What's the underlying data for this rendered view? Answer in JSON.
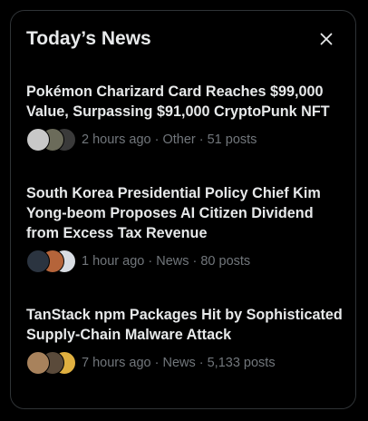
{
  "header": {
    "title": "Today’s News",
    "close_icon": "close-icon"
  },
  "stories": [
    {
      "headline": "Pokémon Charizard Card Reaches $99,000 Value, Surpassing $91,000 CryptoPunk NFT",
      "meta": "2 hours ago · Other · 51 posts",
      "avatar_colors": [
        "#c8c8c8",
        "#6b6b5a",
        "#3a3a3a"
      ]
    },
    {
      "headline": "South Korea Presidential Policy Chief Kim Yong-beom Proposes AI Citizen Dividend from Excess Tax Revenue",
      "meta": "1 hour ago · News · 80 posts",
      "avatar_colors": [
        "#2b3440",
        "#b5643a",
        "#d9dde3"
      ]
    },
    {
      "headline": "TanStack npm Packages Hit by Sophisticated Supply-Chain Malware Attack",
      "meta": "7 hours ago · News · 5,133 posts",
      "avatar_colors": [
        "#a8825c",
        "#5a4a3a",
        "#e0b040"
      ]
    }
  ]
}
